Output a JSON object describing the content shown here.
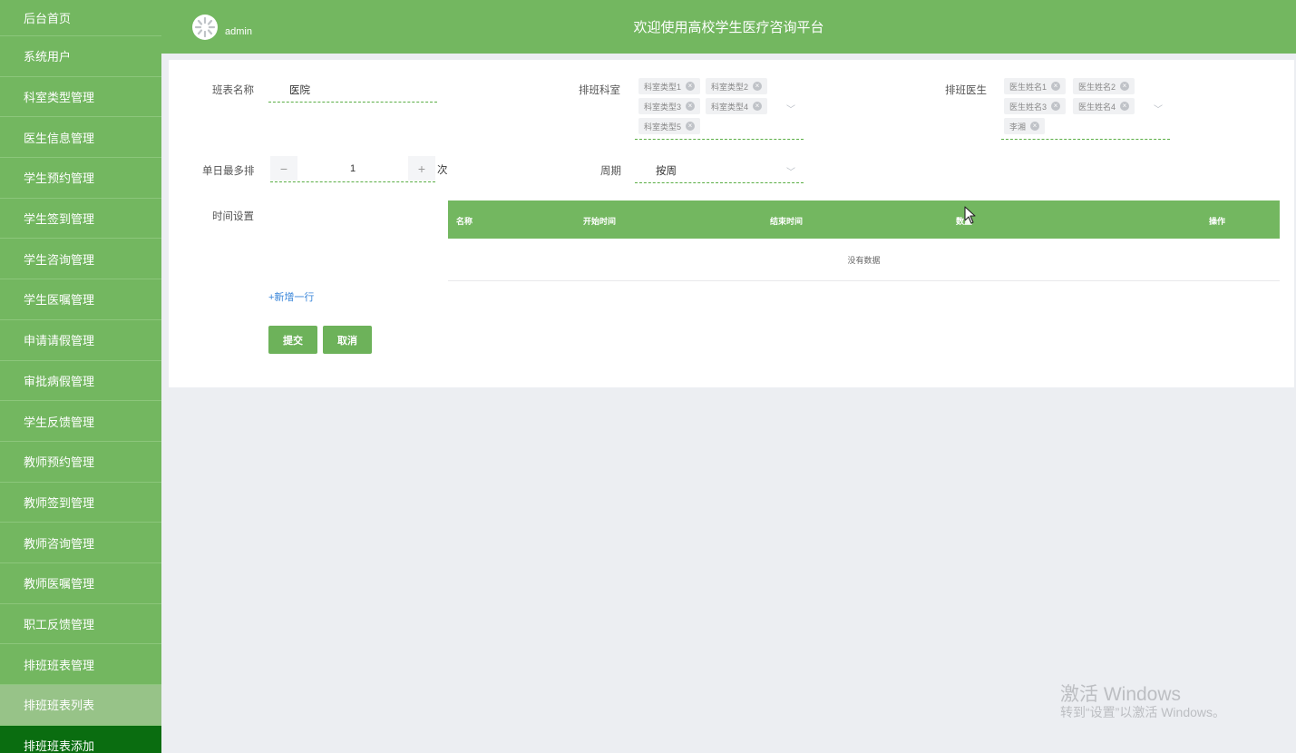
{
  "sidebar": {
    "items": [
      {
        "label": "后台首页"
      },
      {
        "label": "系统用户"
      },
      {
        "label": "科室类型管理"
      },
      {
        "label": "医生信息管理"
      },
      {
        "label": "学生预约管理"
      },
      {
        "label": "学生签到管理"
      },
      {
        "label": "学生咨询管理"
      },
      {
        "label": "学生医嘱管理"
      },
      {
        "label": "申请请假管理"
      },
      {
        "label": "审批病假管理"
      },
      {
        "label": "学生反馈管理"
      },
      {
        "label": "教师预约管理"
      },
      {
        "label": "教师签到管理"
      },
      {
        "label": "教师咨询管理"
      },
      {
        "label": "教师医嘱管理"
      },
      {
        "label": "职工反馈管理"
      },
      {
        "label": "排班班表管理"
      },
      {
        "label": "排班班表列表"
      },
      {
        "label": "排班班表添加"
      }
    ]
  },
  "header": {
    "user": "admin",
    "title": "欢迎使用高校学生医疗咨询平台"
  },
  "form": {
    "name_label": "班表名称",
    "name_value": "医院",
    "dept_label": "排班科室",
    "dept_tags": [
      "科室类型1",
      "科室类型2",
      "科室类型3",
      "科室类型4",
      "科室类型5"
    ],
    "doctor_label": "排班医生",
    "doctor_tags": [
      "医生姓名1",
      "医生姓名2",
      "医生姓名3",
      "医生姓名4",
      "李湘"
    ],
    "max_label": "单日最多排",
    "max_value": "1",
    "max_unit": "次",
    "cycle_label": "周期",
    "cycle_value": "按周",
    "time_label": "时间设置",
    "table_headers": [
      "名称",
      "开始时间",
      "结束时间",
      "数量",
      "操作"
    ],
    "empty_text": "没有数据",
    "add_row": "+新增一行",
    "submit": "提交",
    "cancel": "取消"
  },
  "watermark": {
    "title": "激活 Windows",
    "subtitle": "转到“设置”以激活 Windows。"
  },
  "colors": {
    "primary": "#73b760",
    "active_nav": "#0a6d10",
    "link": "#3a86d9"
  }
}
